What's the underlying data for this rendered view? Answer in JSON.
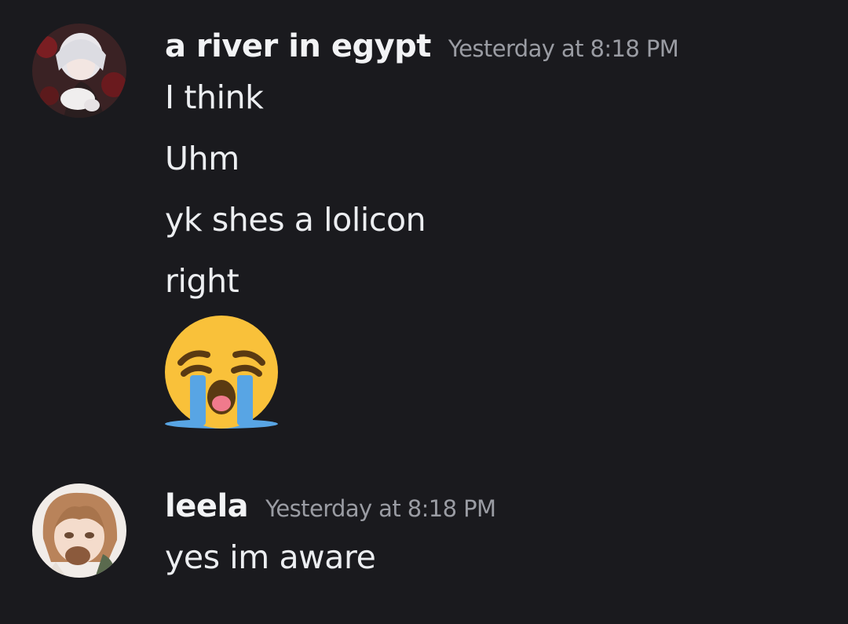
{
  "messages": [
    {
      "username": "a river in egypt",
      "timestamp": "Yesterday at 8:18 PM",
      "avatar": "avatar-white-haired-character",
      "lines": [
        "I think",
        "Uhm",
        "yk shes a lolicon",
        "right"
      ],
      "emoji": "loudly-crying-face-emoji"
    },
    {
      "username": "leela",
      "timestamp": "Yesterday at 8:18 PM",
      "avatar": "avatar-brown-haired-character",
      "lines": [
        "yes im aware"
      ]
    }
  ],
  "colors": {
    "background": "#1a1a1e",
    "username": "#f2f3f5",
    "timestamp": "#9a9ca3",
    "message_text": "#eceef1",
    "emoji_face": "#f9c13a",
    "emoji_tears": "#58a5e4"
  }
}
